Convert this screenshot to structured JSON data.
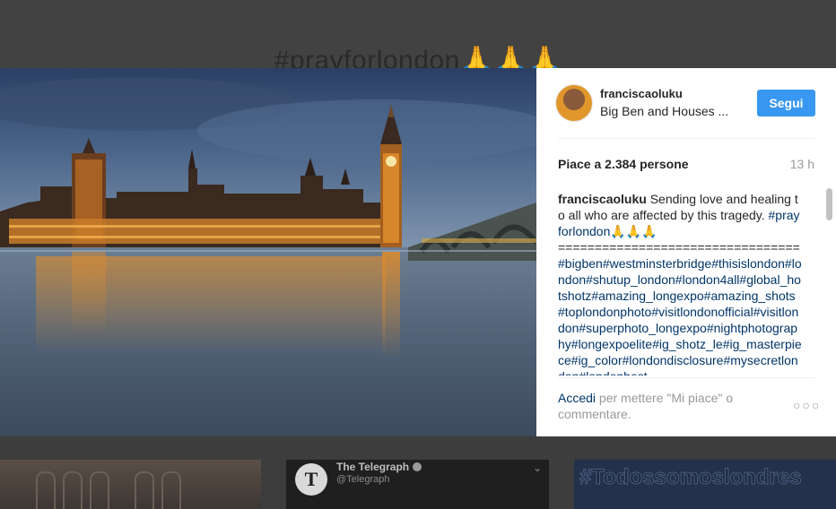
{
  "background": {
    "title": "#prayforlondon🙏🙏🙏",
    "thumbnails": [
      {
        "type": "photo"
      },
      {
        "type": "tweet",
        "name": "The Telegraph",
        "handle": "@Telegraph",
        "logo_letter": "T"
      },
      {
        "type": "text",
        "text": "#Todossomoslondres"
      }
    ]
  },
  "post": {
    "photo_alt": "Big Ben and Houses of Parliament at dusk",
    "author": {
      "username": "franciscaoluku",
      "location": "Big Ben and Houses ...",
      "follow_label": "Segui"
    },
    "likes_label": "Piace a 2.384 persone",
    "time_label": "13 h",
    "caption": {
      "username": "franciscaoluku",
      "text": "Sending love and healing to all who are affected by this tragedy.",
      "first_tag": "#prayforlondon",
      "emoji": "🙏🙏🙏",
      "separator": "=================================",
      "hashtags": "#bigben#westminsterbridge#thisislondon#london#shutup_london#london4all#global_hotshotz#amazing_longexpo#amazing_shots#toplondonphoto#visitlondonofficial#visitlondon#superphoto_longexpo#nightphotography#longexpoelite#ig_shotz_le#ig_masterpiece#ig_color#londondisclosure#mysecretlondon#londonbest"
    },
    "login_prompt": {
      "link": "Accedi",
      "text": " per mettere \"Mi piace\" o commentare."
    },
    "more_label": "○○○"
  },
  "colors": {
    "accent": "#3897f0",
    "hashtag": "#003569",
    "muted": "#999999",
    "text": "#262626"
  }
}
